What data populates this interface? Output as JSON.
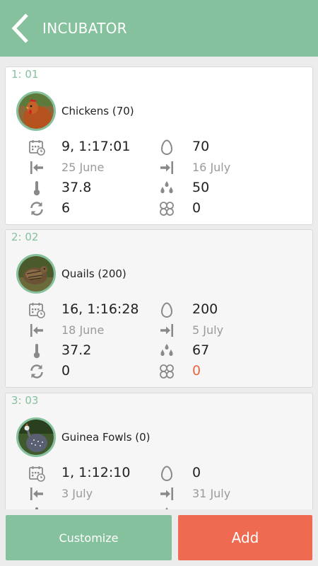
{
  "header": {
    "title": "INCUBATOR"
  },
  "cards": [
    {
      "slot": "1: 01",
      "title": "Chickens (70)",
      "duration": "9, 1:17:01",
      "eggs": "70",
      "start_date": "25 June",
      "end_date": "16 July",
      "temperature": "37.8",
      "humidity": "50",
      "turns": "6",
      "ventilation": "0"
    },
    {
      "slot": "2: 02",
      "title": "Quails (200)",
      "duration": "16, 1:16:28",
      "eggs": "200",
      "start_date": "18 June",
      "end_date": "5 July",
      "temperature": "37.2",
      "humidity": "67",
      "turns": "0",
      "ventilation": "0"
    },
    {
      "slot": "3: 03",
      "title": "Guinea Fowls (0)",
      "duration": "1, 1:12:10",
      "eggs": "0",
      "start_date": "3 July",
      "end_date": "31 July"
    }
  ],
  "footer": {
    "customize_label": "Customize",
    "add_label": "Add"
  },
  "colors": {
    "accent": "#85c19d",
    "add": "#ee6a50",
    "alert": "#e8673f"
  }
}
